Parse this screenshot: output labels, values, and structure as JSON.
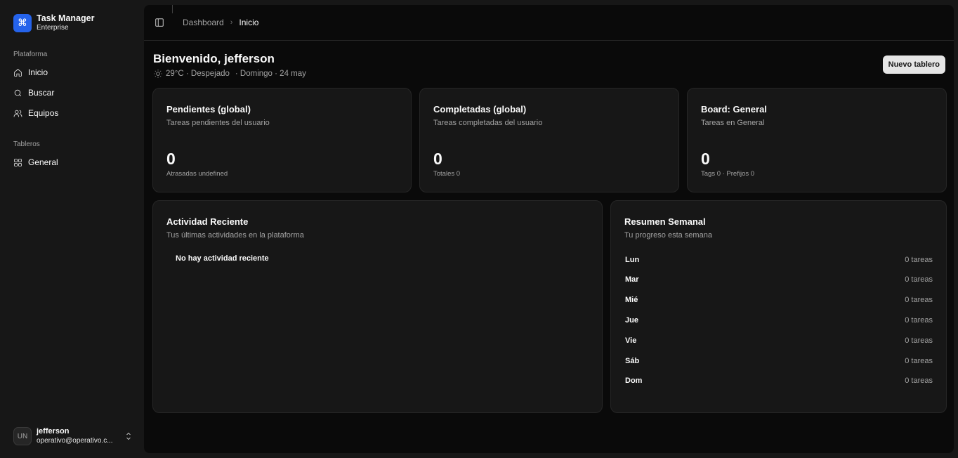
{
  "brand": {
    "name": "Task Manager",
    "subtitle": "Enterprise",
    "icon": "command-icon"
  },
  "sidebar": {
    "platform_label": "Plataforma",
    "platform_items": [
      {
        "label": "Inicio",
        "icon": "home-icon"
      },
      {
        "label": "Buscar",
        "icon": "search-icon"
      },
      {
        "label": "Equipos",
        "icon": "users-icon"
      }
    ],
    "boards_label": "Tableros",
    "board_items": [
      {
        "label": "General",
        "icon": "grid-icon"
      }
    ]
  },
  "user": {
    "initials": "UN",
    "name": "jefferson",
    "email": "operativo@operativo.c..."
  },
  "breadcrumb": {
    "parent": "Dashboard",
    "separator": "›",
    "current": "Inicio"
  },
  "header": {
    "title": "Bienvenido, jefferson",
    "weather": "29°C · Despejado",
    "date": "· Domingo · 24 may",
    "new_board_label": "Nuevo tablero"
  },
  "stats": [
    {
      "title": "Pendientes (global)",
      "description": "Tareas pendientes del usuario",
      "value": "0",
      "footer": "Atrasadas undefined"
    },
    {
      "title": "Completadas (global)",
      "description": "Tareas completadas del usuario",
      "value": "0",
      "footer": "Totales 0"
    },
    {
      "title": "Board: General",
      "description": "Tareas en General",
      "value": "0",
      "footer": "Tags 0 · Prefijos 0"
    }
  ],
  "activity": {
    "title": "Actividad Reciente",
    "description": "Tus últimas actividades en la plataforma",
    "empty": "No hay actividad reciente"
  },
  "weekly": {
    "title": "Resumen Semanal",
    "description": "Tu progreso esta semana",
    "days": [
      {
        "day": "Lun",
        "count": "0 tareas"
      },
      {
        "day": "Mar",
        "count": "0 tareas"
      },
      {
        "day": "Mié",
        "count": "0 tareas"
      },
      {
        "day": "Jue",
        "count": "0 tareas"
      },
      {
        "day": "Vie",
        "count": "0 tareas"
      },
      {
        "day": "Sáb",
        "count": "0 tareas"
      },
      {
        "day": "Dom",
        "count": "0 tareas"
      }
    ]
  },
  "colors": {
    "accent": "#2563eb",
    "background": "#0a0a0a",
    "card": "#171717",
    "border": "#262626"
  }
}
